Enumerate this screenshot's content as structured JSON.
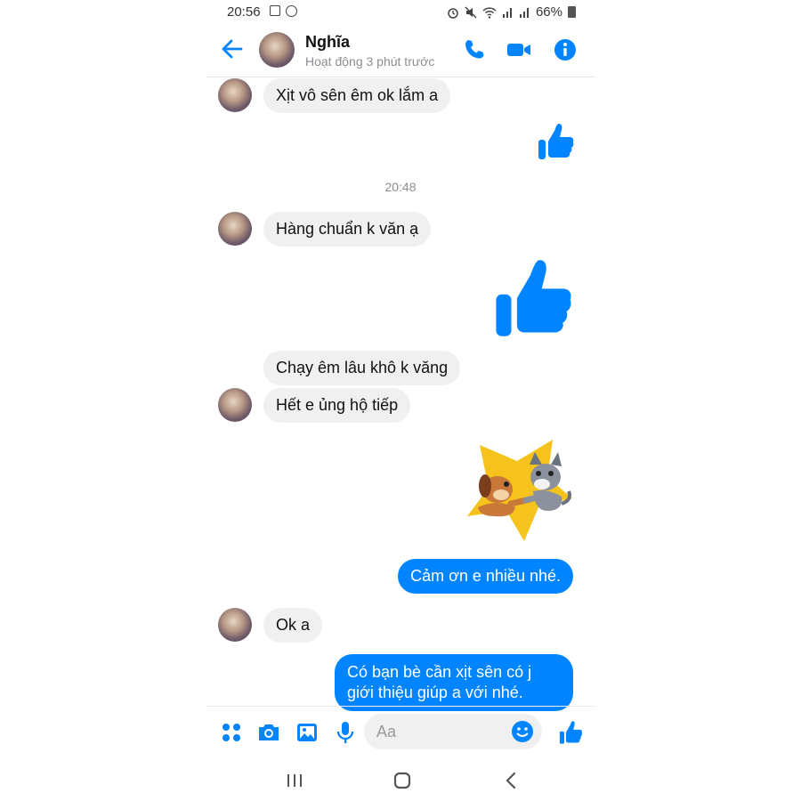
{
  "status_bar": {
    "time": "20:56",
    "battery": "66%"
  },
  "header": {
    "name": "Nghĩa",
    "status": "Hoạt động 3 phút trước"
  },
  "messages": {
    "m1": "Xịt vô sên êm ok lắm a",
    "timestamp": "20:48",
    "m2": "Hàng chuẩn k văn ạ",
    "m3": "Chạy êm lâu khô k văng",
    "m4": "Hết e ủng hộ tiếp",
    "m5": "Cảm ơn e nhiều nhé.",
    "m6": "Ok a",
    "m7": "Có bạn bè cần xịt sên có j giới thiệu giúp a với nhé."
  },
  "composer": {
    "placeholder": "Aa"
  },
  "colors": {
    "accent": "#0084ff",
    "incoming": "#f0f0f0",
    "sticker_star": "#f6c21c"
  },
  "icons": [
    "back-arrow-icon",
    "phone-icon",
    "video-icon",
    "info-icon",
    "thumbs-up-icon",
    "menu-dots-icon",
    "camera-icon",
    "gallery-icon",
    "mic-icon",
    "emoji-icon",
    "recent-apps-icon",
    "home-icon",
    "back-nav-icon"
  ]
}
